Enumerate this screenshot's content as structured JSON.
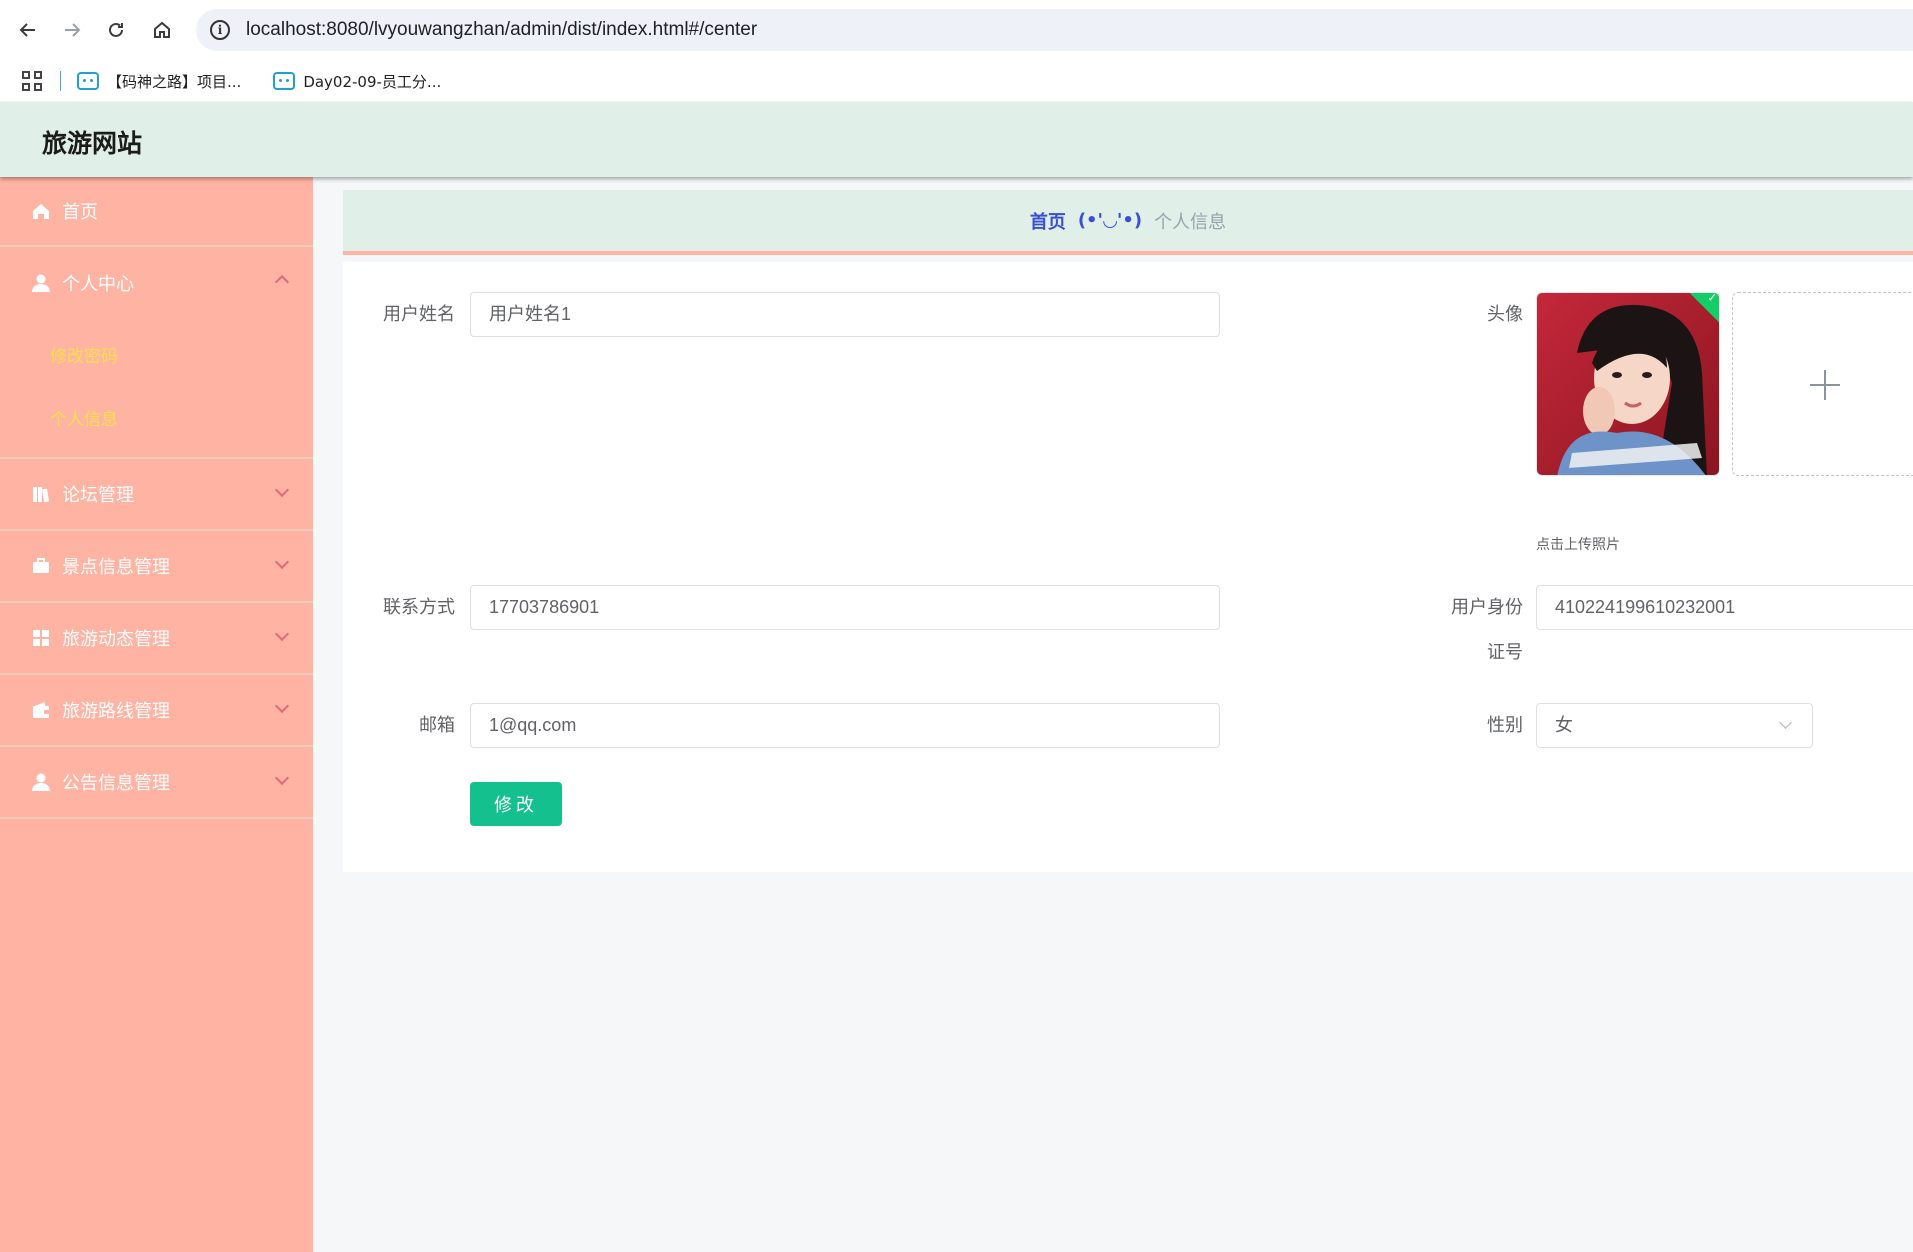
{
  "browser": {
    "url": "localhost:8080/lvyouwangzhan/admin/dist/index.html#/center",
    "bookmarks": [
      {
        "label": "【码神之路】项目..."
      },
      {
        "label": "Day02-09-员工分..."
      }
    ]
  },
  "app": {
    "title": "旅游网站"
  },
  "sidebar": {
    "home": "首页",
    "personal_center": {
      "label": "个人中心",
      "sub": [
        "修改密码",
        "个人信息"
      ]
    },
    "items": [
      {
        "label": "论坛管理",
        "icon": "book-icon"
      },
      {
        "label": "景点信息管理",
        "icon": "briefcase-icon"
      },
      {
        "label": "旅游动态管理",
        "icon": "grid-icon"
      },
      {
        "label": "旅游路线管理",
        "icon": "wallet-icon"
      },
      {
        "label": "公告信息管理",
        "icon": "user-icon"
      }
    ]
  },
  "breadcrumb": {
    "home": "首页",
    "separator": "(•'◡'•)",
    "current": "个人信息"
  },
  "form": {
    "username_label": "用户姓名",
    "username_value": "用户姓名1",
    "avatar_label": "头像",
    "upload_tip": "点击上传照片",
    "phone_label": "联系方式",
    "phone_value": "17703786901",
    "idcard_label_1": "用户身份",
    "idcard_label_2": "证号",
    "idcard_value": "410224199610232001",
    "email_label": "邮箱",
    "email_value": "1@qq.com",
    "gender_label": "性别",
    "gender_value": "女",
    "submit_label": "修改"
  },
  "colors": {
    "sidebar_bg": "#ffb3a3",
    "header_bg": "#e0efe8",
    "submenu_text": "#f5e04a",
    "breadcrumb_home": "#3b4fd6",
    "button_bg": "#13c08e",
    "success_badge": "#13ce66"
  }
}
